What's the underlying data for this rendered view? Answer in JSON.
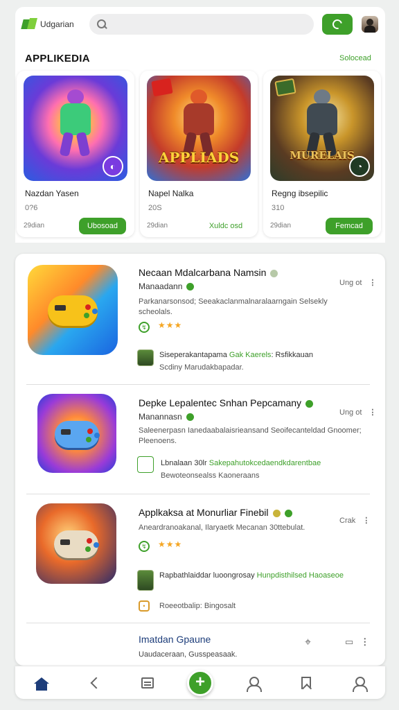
{
  "header": {
    "logo_text": "Udgarian",
    "search": {
      "placeholder": ""
    }
  },
  "featured": {
    "title": "APPLIKEDIA",
    "link": "Solocead",
    "cards": [
      {
        "art_text": "",
        "name": "Nazdan Yasen",
        "num": "0?6",
        "size": "29dian",
        "action": "Ubosoad",
        "action_style": "filled"
      },
      {
        "art_text": "APPLIADS",
        "name": "Napel Nalka",
        "num": "20S",
        "size": "29dian",
        "action": "Xuldc osd",
        "action_style": "text"
      },
      {
        "art_text": "MURELAIS",
        "name": "Regng ibsepilic",
        "num": "310",
        "size": "29dian",
        "action": "Femcad",
        "action_style": "filled"
      }
    ]
  },
  "list": [
    {
      "title": "Necaan Mdalcarbana Namsin",
      "subtitle": "Manaadann",
      "desc": "Parkanarsonsod; Seeakaclanmalnaralaarngain Selsekly scheolals.",
      "rating": "★★★",
      "meta_a": "Siseperakantapama",
      "meta_b": "Gak Kaerels",
      "meta_c": ": Rsfikkauan",
      "meta2": "Scdiny Marudakbapadar.",
      "action": "Ung ot"
    },
    {
      "title": "Depke Lepalentec Snhan Pepcamany",
      "subtitle": "Manannasn",
      "desc": "Saleenerpasn Ianedaabalaisrieansand Seoifecanteldad Gnoomer; Pleenoens.",
      "rating": "",
      "meta_a": "Lbnalaan 30lr",
      "meta_b": "Sakepahutokcedaendkdarentbae",
      "meta_c": "",
      "meta2": "Bewoteonsealss Kaoneraans",
      "action": "Ung ot"
    },
    {
      "title": "Applkaksa at Monurliar Finebil",
      "subtitle": "",
      "desc": "Aneardranoakanal, Ilaryaetk Mecanan 30ttebulat.",
      "rating": "★★★",
      "meta_a": "Rapbathlaiddar luoongrosay",
      "meta_b": "Hunpdisthilsed Haoaseoe",
      "meta_c": "",
      "meta2": "Roeeotbalip: Bingosalt",
      "action": "Crak"
    },
    {
      "title": "Imatdan Gpaune",
      "subtitle": "Uaudaceraan, Gusspeasaak.",
      "desc": "",
      "rating": "",
      "meta_a": "",
      "meta_b": "",
      "meta_c": "",
      "meta2": "",
      "action": ""
    }
  ],
  "colors": {
    "accent": "#3ea02a",
    "nav_active": "#1d3d7a"
  },
  "icons": {
    "nav": [
      "home-icon",
      "back-icon",
      "list-icon",
      "add-icon",
      "profile-icon",
      "bookmark-icon",
      "account-icon"
    ]
  },
  "nav": {
    "add_symbol": "+"
  }
}
